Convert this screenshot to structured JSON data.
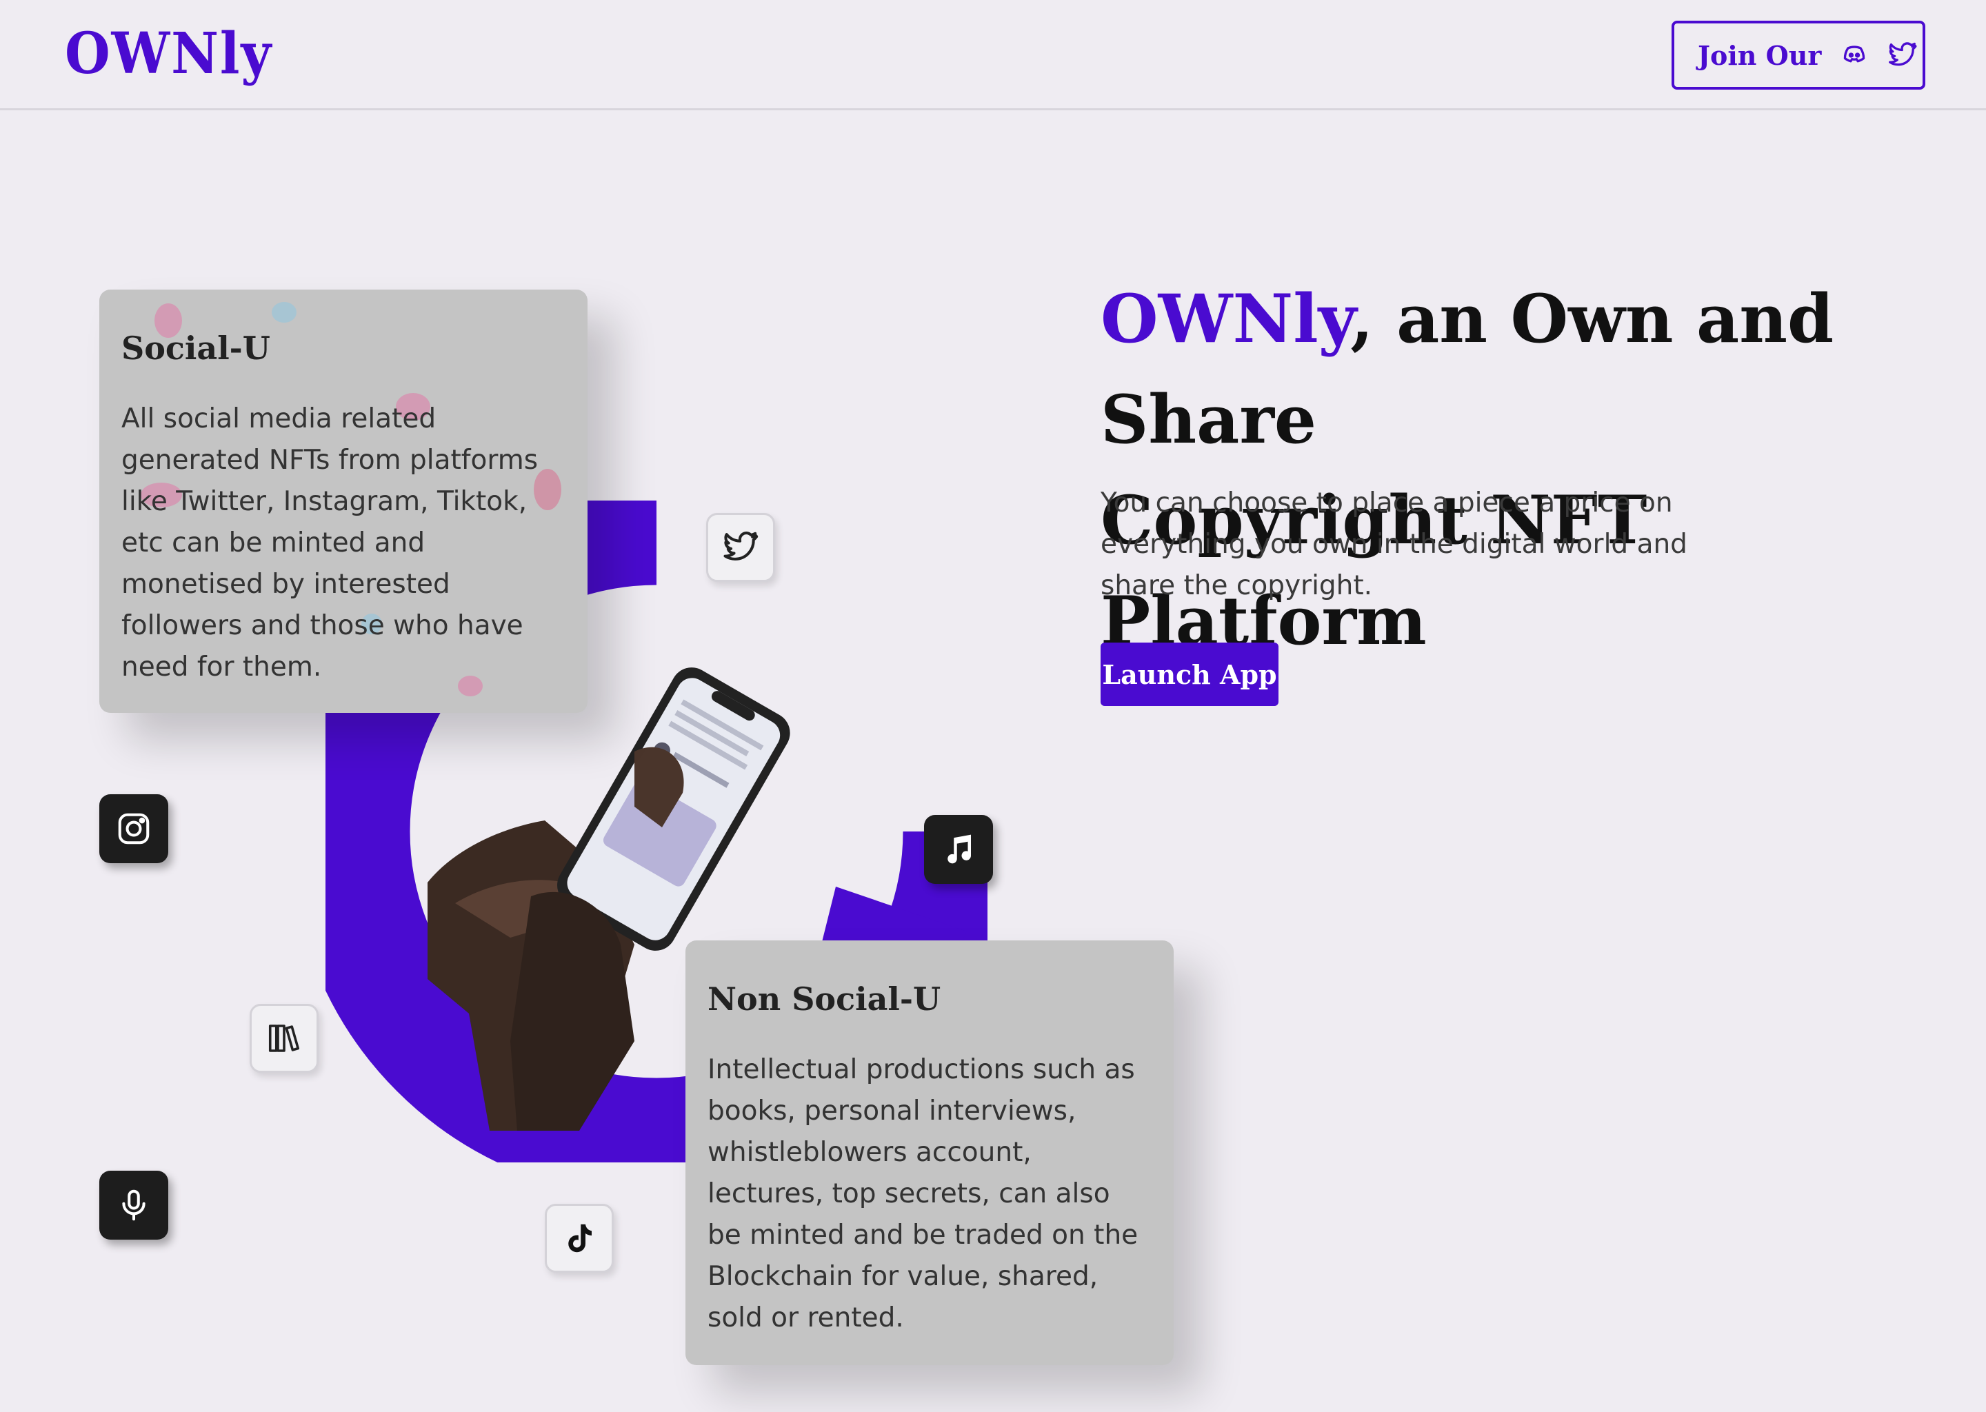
{
  "header": {
    "logo": "OWNly",
    "join_label": "Join Our",
    "join_icons": [
      "discord-icon",
      "twitter-icon"
    ]
  },
  "hero": {
    "brand": "OWNly",
    "title_rest_line1": ", an Own and Share",
    "title_line2": "Copyright NFT Platform",
    "description": "You can choose to place a piece a price on everything you own in the digital world and share the copyright.",
    "cta": "Launch App"
  },
  "cards": {
    "social": {
      "title": "Social-U",
      "text": "All social media related generated NFTs from platforms like Twitter, Instagram, Tiktok, etc can be minted and monetised by interested followers and those who have need for them."
    },
    "non_social": {
      "title": "Non Social-U",
      "text": "Intellectual productions such as books, personal interviews, whistleblowers account, lectures, top secrets, can also be minted and be traded on the Blockchain for value, shared, sold or rented."
    }
  },
  "floating_icons": [
    "twitter-icon",
    "instagram-icon",
    "music-note-icon",
    "books-icon",
    "microphone-icon",
    "tiktok-icon"
  ],
  "colors": {
    "accent": "#4a0bd0",
    "background": "#efecf2",
    "card": "#c4c4c4",
    "dark_tile": "#1d1d1d"
  }
}
